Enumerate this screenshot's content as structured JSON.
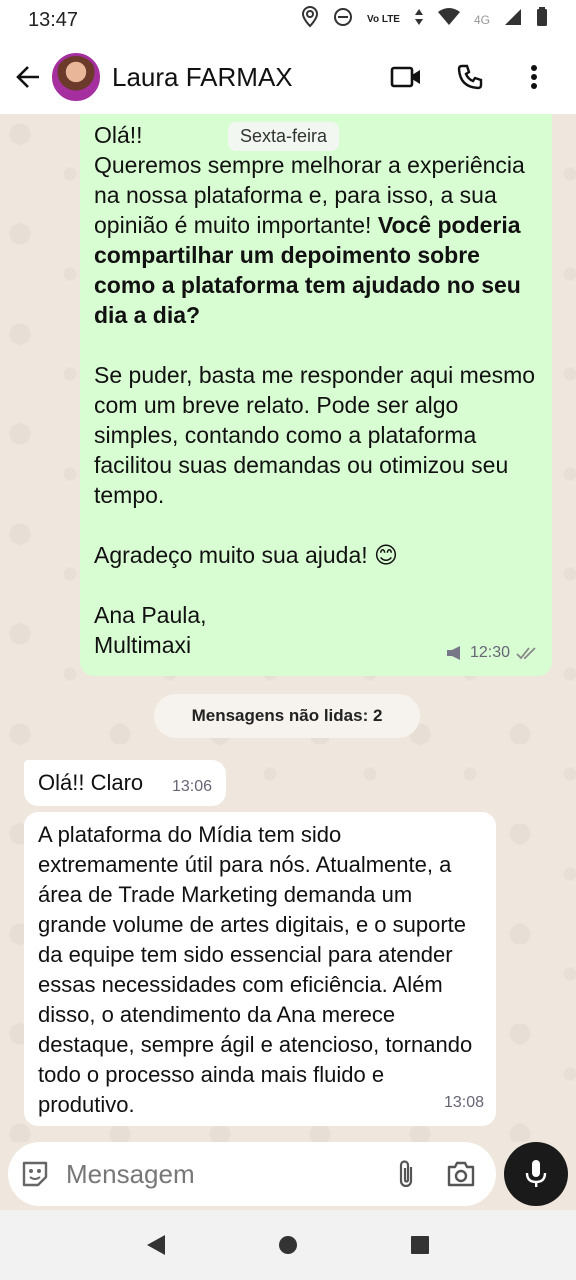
{
  "status_bar": {
    "time": "13:47",
    "network": "Vo LTE",
    "network_gen": "4G",
    "icons": [
      "location-icon",
      "dnd-icon",
      "data-arrows-icon",
      "wifi-icon",
      "signal-icon",
      "battery-icon"
    ]
  },
  "header": {
    "contact_name": "Laura FARMAX",
    "icons": [
      "back-arrow-icon",
      "video-call-icon",
      "phone-icon",
      "more-vert-icon"
    ]
  },
  "chat": {
    "date_chip": "Sexta-feira",
    "outgoing": {
      "para1": "Olá!!\nQueremos sempre melhorar a experiência na nossa plataforma e, para isso, a sua opinião é muito importante! ",
      "para1_bold": "Você poderia compartilhar um depoimento sobre como a plataforma tem ajudado no seu dia a dia?",
      "para2": "Se puder, basta me responder aqui mesmo com um breve relato. Pode ser algo simples, contando como a plataforma facilitou suas demandas ou otimizou seu tempo.",
      "para3": "Agradeço muito sua ajuda! 😊",
      "para4": "Ana Paula,\nMultimaxi",
      "time": "12:30"
    },
    "unread_label": "Mensagens não lidas: 2",
    "incoming": [
      {
        "text": "Olá!! Claro",
        "time": "13:06"
      },
      {
        "text": "A plataforma do Mídia tem sido extremamente útil para nós. Atualmente, a área de Trade Marketing demanda um grande volume de artes digitais, e o suporte da equipe tem sido essencial para atender essas necessidades com eficiência. Além disso, o atendimento da Ana merece destaque, sempre ágil e atencioso, tornando todo o processo ainda mais fluido e produtivo.",
        "time": "13:08"
      }
    ]
  },
  "composer": {
    "placeholder": "Mensagem",
    "icons": [
      "sticker-icon",
      "attach-icon",
      "camera-icon",
      "mic-icon"
    ]
  },
  "nav_bar": {
    "icons": [
      "back-triangle-icon",
      "home-circle-icon",
      "recents-square-icon"
    ]
  },
  "colors": {
    "outgoing_bubble": "#d9fdd3",
    "incoming_bubble": "#ffffff",
    "chat_bg": "#efe7dd",
    "mic_button": "#1a1a1a"
  }
}
